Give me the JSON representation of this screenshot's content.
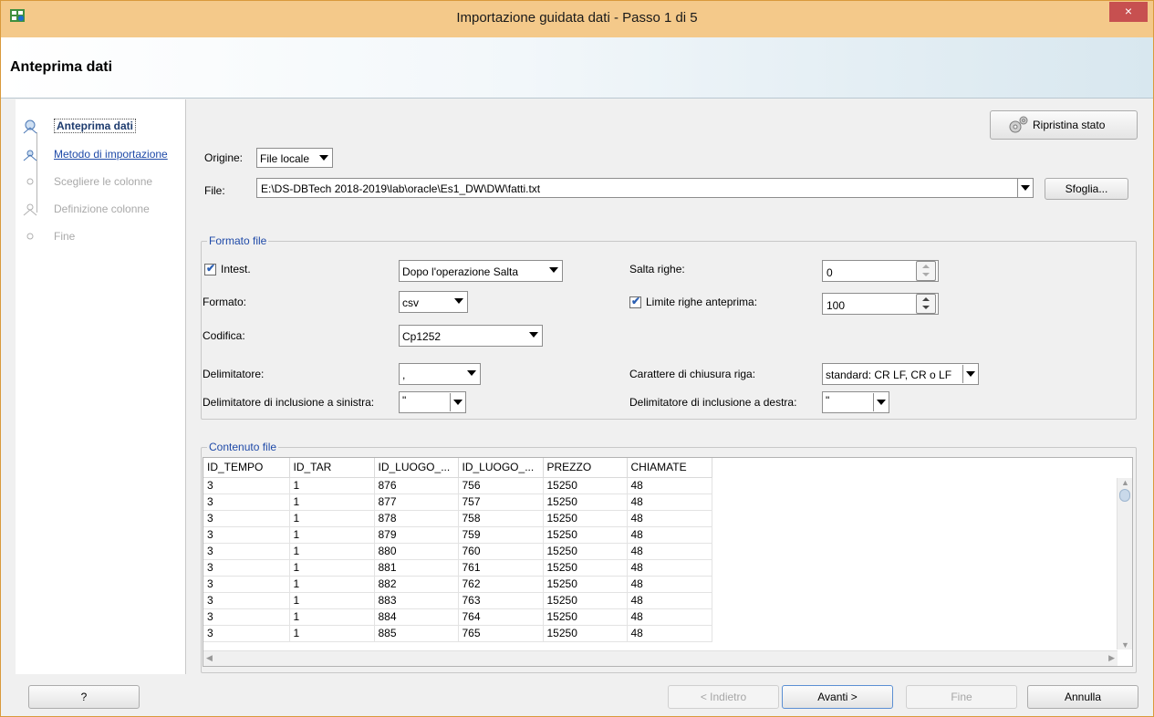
{
  "window": {
    "title": "Importazione guidata dati - Passo 1 di 5",
    "close_label": "×",
    "header_title": "Anteprima dati"
  },
  "steps": [
    {
      "label": "Anteprima dati",
      "state": "active"
    },
    {
      "label": "Metodo di importazione",
      "state": "link"
    },
    {
      "label": "Scegliere le colonne",
      "state": "disabled"
    },
    {
      "label": "Definizione colonne",
      "state": "disabled"
    },
    {
      "label": "Fine",
      "state": "disabled"
    }
  ],
  "toolbar": {
    "reset_label": "Ripristina stato"
  },
  "source": {
    "origin_label": "Origine:",
    "origin_value": "File locale",
    "file_label": "File:",
    "file_path": "E:\\DS-DBTech 2018-2019\\lab\\oracle\\Es1_DW\\DW\\fatti.txt",
    "browse_label": "Sfoglia..."
  },
  "format": {
    "group_title": "Formato file",
    "header_label": "Intest.",
    "header_checked": true,
    "after_op_value": "Dopo l'operazione Salta",
    "skip_rows_label": "Salta righe:",
    "skip_rows_value": "0",
    "format_label": "Formato:",
    "format_value": "csv",
    "preview_limit_label": "Limite righe anteprima:",
    "preview_limit_checked": true,
    "preview_limit_value": "100",
    "encoding_label": "Codifica:",
    "encoding_value": "Cp1252",
    "delimiter_label": "Delimitatore:",
    "delimiter_value": ",",
    "line_term_label": "Carattere di chiusura riga:",
    "line_term_value": "standard: CR LF, CR o LF",
    "left_enclosure_label": "Delimitatore di inclusione a sinistra:",
    "left_enclosure_value": "\"",
    "right_enclosure_label": "Delimitatore di inclusione a destra:",
    "right_enclosure_value": "\""
  },
  "content": {
    "group_title": "Contenuto file",
    "columns": [
      "ID_TEMPO",
      "ID_TAR",
      "ID_LUOGO_...",
      "ID_LUOGO_...",
      "PREZZO",
      "CHIAMATE"
    ],
    "rows": [
      [
        "3",
        "1",
        "876",
        "756",
        "15250",
        "48"
      ],
      [
        "3",
        "1",
        "877",
        "757",
        "15250",
        "48"
      ],
      [
        "3",
        "1",
        "878",
        "758",
        "15250",
        "48"
      ],
      [
        "3",
        "1",
        "879",
        "759",
        "15250",
        "48"
      ],
      [
        "3",
        "1",
        "880",
        "760",
        "15250",
        "48"
      ],
      [
        "3",
        "1",
        "881",
        "761",
        "15250",
        "48"
      ],
      [
        "3",
        "1",
        "882",
        "762",
        "15250",
        "48"
      ],
      [
        "3",
        "1",
        "883",
        "763",
        "15250",
        "48"
      ],
      [
        "3",
        "1",
        "884",
        "764",
        "15250",
        "48"
      ],
      [
        "3",
        "1",
        "885",
        "765",
        "15250",
        "48"
      ]
    ]
  },
  "footer": {
    "help_label": "?",
    "back_label": "< Indietro",
    "next_label": "Avanti >",
    "finish_label": "Fine",
    "cancel_label": "Annulla"
  },
  "colors": {
    "title_bar": "#f4c98a",
    "close": "#c75050",
    "accent_link": "#1f4aa8"
  },
  "icons": {
    "app": "import-wizard-icon",
    "reset": "gear-icon",
    "step": "step-node-icon"
  }
}
